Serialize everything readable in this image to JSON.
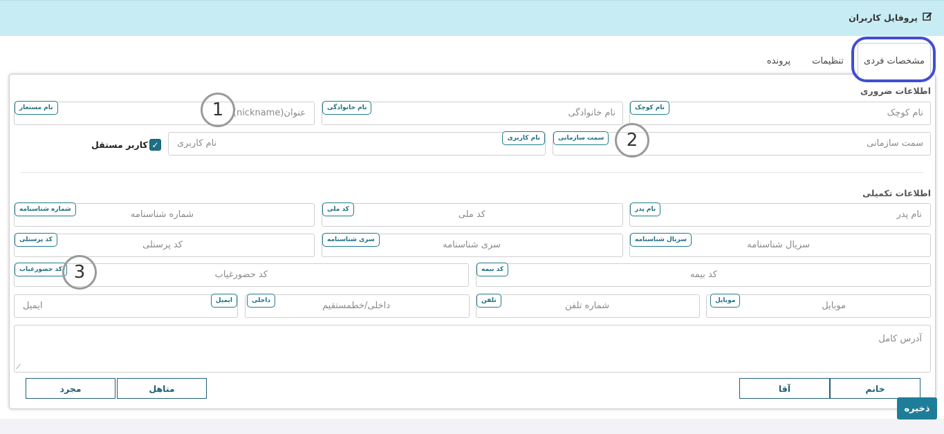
{
  "header": {
    "title": "پروفایل کاربران",
    "icon": "edit-icon"
  },
  "tabs": [
    {
      "label": "مشخصات فردی",
      "active": true
    },
    {
      "label": "تنظیمات"
    },
    {
      "label": "پرونده"
    }
  ],
  "sections": {
    "required": "اطلاعات ضروری",
    "extra": "اطلاعات تکمیلی"
  },
  "fields": {
    "first_name": {
      "badge": "نام کوچک",
      "placeholder": "نام کوچک"
    },
    "last_name": {
      "badge": "نام خانوادگی",
      "placeholder": "نام خانوادگی"
    },
    "nickname": {
      "badge": "نام مستعار",
      "placeholder": "عنوان(nickname)"
    },
    "org_position": {
      "badge": "سمت سازمانی",
      "placeholder": "سمت سازمانی"
    },
    "username": {
      "badge": "نام کاربری",
      "placeholder": "نام کاربری"
    },
    "father_name": {
      "badge": "نام پدر",
      "placeholder": "نام پدر"
    },
    "national_code": {
      "badge": "کد ملی",
      "placeholder": "کد ملی"
    },
    "id_number": {
      "badge": "شماره شناسنامه",
      "placeholder": "شماره شناسنامه"
    },
    "id_serial": {
      "badge": "سریال شناسنامه",
      "placeholder": "سریال شناسنامه"
    },
    "id_series": {
      "badge": "سری شناسنامه",
      "placeholder": "سری شناسنامه"
    },
    "personnel_code": {
      "badge": "کد پرسنلی",
      "placeholder": "کد پرسنلی"
    },
    "insurance_code": {
      "badge": "کد بیمه",
      "placeholder": "کد بیمه"
    },
    "attendance_code": {
      "badge": "کد حضورغیاب",
      "placeholder": "کد حضورغیاب"
    },
    "mobile": {
      "badge": "موبایل",
      "placeholder": "موبایل"
    },
    "phone": {
      "badge": "تلفن",
      "placeholder": "شماره تلفن"
    },
    "extension": {
      "badge": "داخلی",
      "placeholder": "داخلی/خطمستقیم"
    },
    "email": {
      "badge": "ایمیل",
      "placeholder": "ایمیل"
    },
    "address": {
      "placeholder": "آدرس کامل"
    }
  },
  "independent_user": {
    "label": "کاربر مستقل",
    "checked": true
  },
  "markers": [
    "1",
    "2",
    "3"
  ],
  "buttons": {
    "female": "خانم",
    "male": "آقا",
    "married": "متاهل",
    "single": "مجرد",
    "save": "ذخیره"
  },
  "colors": {
    "header_bg": "#c8ecf4",
    "accent": "#1e7d99",
    "tab_highlight": "#3f4ed1"
  }
}
